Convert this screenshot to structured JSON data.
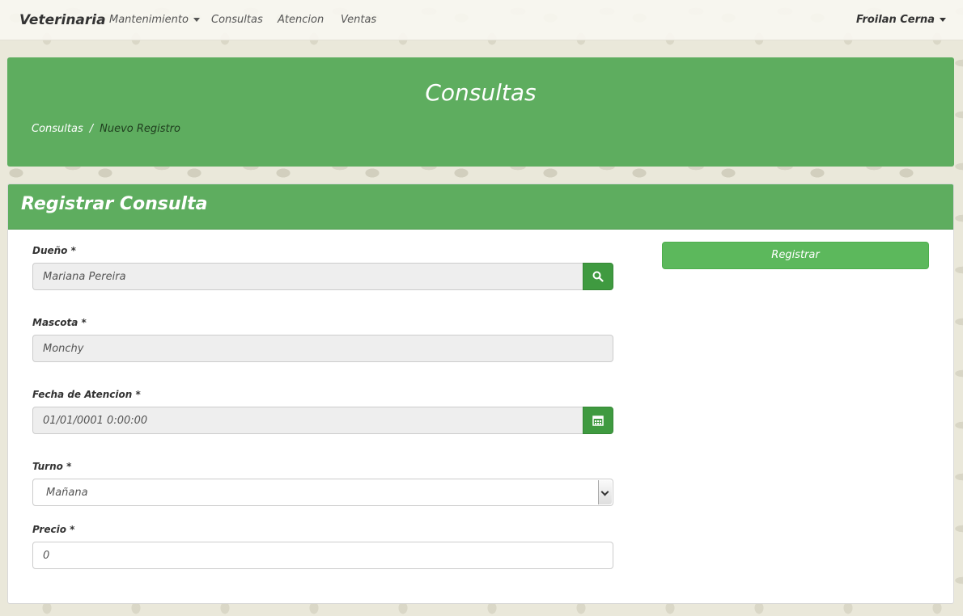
{
  "navbar": {
    "brand": "Veterinaria",
    "items": [
      {
        "label": "Mantenimiento",
        "dropdown": true
      },
      {
        "label": "Consultas"
      },
      {
        "label": "Atencion"
      },
      {
        "label": "Ventas"
      }
    ],
    "user": "Froilan Cerna"
  },
  "header": {
    "title": "Consultas",
    "breadcrumb": {
      "link": "Consultas",
      "separator": "/",
      "current": "Nuevo Registro"
    }
  },
  "form": {
    "title": "Registrar Consulta",
    "owner": {
      "label": "Dueño *",
      "value": "Mariana Pereira",
      "button_icon": "search-icon"
    },
    "pet": {
      "label": "Mascota *",
      "value": "Monchy"
    },
    "date": {
      "label": "Fecha de Atencion *",
      "value": "01/01/0001 0:00:00",
      "button_icon": "calendar-icon"
    },
    "shift": {
      "label": "Turno *",
      "selected": "Mañana"
    },
    "price": {
      "label": "Precio *",
      "value": "0"
    },
    "submit_label": "Registrar"
  },
  "colors": {
    "panel_green": "#5ead5f",
    "button_green": "#5cb85c",
    "addon_green": "#3f9a40"
  }
}
